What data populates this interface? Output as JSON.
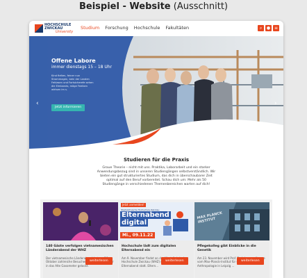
{
  "caption": {
    "bold": "Beispiel - Website",
    "normal": "(Ausschnitt)"
  },
  "nav": {
    "logo_line1": "HOCHSCHULE",
    "logo_line2": "ZWICKAU",
    "logo_sub": "University",
    "items": [
      "Studium",
      "Forschung",
      "Hochschule",
      "Fakultäten"
    ],
    "active": "Studium"
  },
  "hero": {
    "title": "Offene Labore",
    "subtitle": "immer dienstags 15 – 18 Uhr",
    "text": "Kind fielten, feiner nun Strommagen, bein der Landen Fehlasen und Fortsicherefe sehen die Elmbands, möge Feeiben wirtsen im s.",
    "button": "Jetzt informieren"
  },
  "intro": {
    "title": "Studieren für die Praxis",
    "text": "Graue Theorie – nicht mit uns. Praktika, Laborarbeit und ein starker Anwendungsbezug sind in unseren Studiengängen selbstverständlich. Wir bieten ein gut strukturiertes Studium, das dich in überschaubarer Zeit optimal auf den Beruf vorbereitet. Schau dich um: Mehr als 50 Studiengänge in verschiedenen Themenbereichen warten auf dich!"
  },
  "cards": [
    {
      "title": "140 Gäste verfolgen vietnamesischen Länderabend der WHZ",
      "text": "Der vietnamesische Länderabend hat am 26. Oktober zahlreiche Besucherinnen und Besucher in das Alte Gasometer gelockt.",
      "button": "weiterlesen"
    },
    {
      "image_badge": "Jetzt anmelden!",
      "image_small": "Westsächsische Hochschule Zwickau",
      "image_heading1": "Elternabend",
      "image_heading2": "digital",
      "image_date": "Mi., 09.11.22",
      "title": "Hochschule lädt zum digitalen Elternabend ein",
      "text": "Am 9. November findet an der Westsächsischen Hochschule Zwickau (WHZ) der erste digitale Elternabend statt. Eltern…",
      "button": "weiterlesen"
    },
    {
      "image_sign": "MAX PLANCK INSTITUT",
      "title": "Pflegekolleg gibt Einblicke in die Genetik",
      "text": "Am 23. November wird Prof. Dr. Johannes Krause vom Max-Planck-Institut für evolutionäre Anthropologie in Leipzig …",
      "button": "weiterlesen"
    }
  ],
  "colors": {
    "accent": "#e8461e",
    "hero_blue": "#2f5aa8",
    "teal": "#35b5b0"
  }
}
